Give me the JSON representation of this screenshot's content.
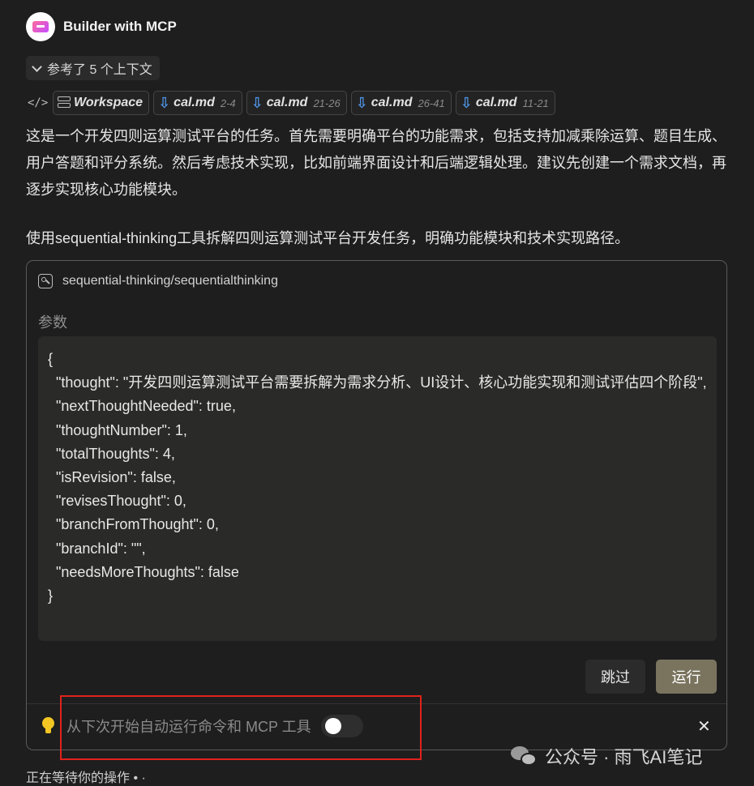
{
  "header": {
    "title": "Builder with MCP",
    "avatar_icon": "builder-avatar-icon"
  },
  "context": {
    "label": "参考了 5 个上下文"
  },
  "references": [
    {
      "name": "Workspace",
      "range": ""
    },
    {
      "name": "cal.md",
      "range": "2-4"
    },
    {
      "name": "cal.md",
      "range": "21-26"
    },
    {
      "name": "cal.md",
      "range": "26-41"
    },
    {
      "name": "cal.md",
      "range": "11-21"
    }
  ],
  "message": {
    "paragraph1": "这是一个开发四则运算测试平台的任务。首先需要明确平台的功能需求，包括支持加减乘除运算、题目生成、用户答题和评分系统。然后考虑技术实现，比如前端界面设计和后端逻辑处理。建议先创建一个需求文档，再逐步实现核心功能模块。",
    "paragraph2": "使用sequential-thinking工具拆解四则运算测试平台开发任务，明确功能模块和技术实现路径。"
  },
  "tool_call": {
    "name": "sequential-thinking/sequentialthinking",
    "params_label": "参数",
    "code_lines": [
      "{",
      "  \"thought\": \"开发四则运算测试平台需要拆解为需求分析、UI设计、核心功能实现和测试评估四个阶段\",",
      "  \"nextThoughtNeeded\": true,",
      "  \"thoughtNumber\": 1,",
      "  \"totalThoughts\": 4,",
      "  \"isRevision\": false,",
      "  \"revisesThought\": 0,",
      "  \"branchFromThought\": 0,",
      "  \"branchId\": \"\",",
      "  \"needsMoreThoughts\": false",
      "}"
    ],
    "skip_label": "跳过",
    "run_label": "运行",
    "auto_run_label": "从下次开始自动运行命令和 MCP 工具",
    "auto_run_enabled": false,
    "close_label": "✕"
  },
  "status": {
    "waiting": "正在等待你的操作 • ·"
  },
  "watermark": {
    "text": "公众号 · 雨飞AI笔记"
  },
  "colors": {
    "accent_run": "#7a745f",
    "highlight_border": "#e0221c",
    "file_icon": "#4f95e8",
    "bulb": "#f3c623"
  }
}
